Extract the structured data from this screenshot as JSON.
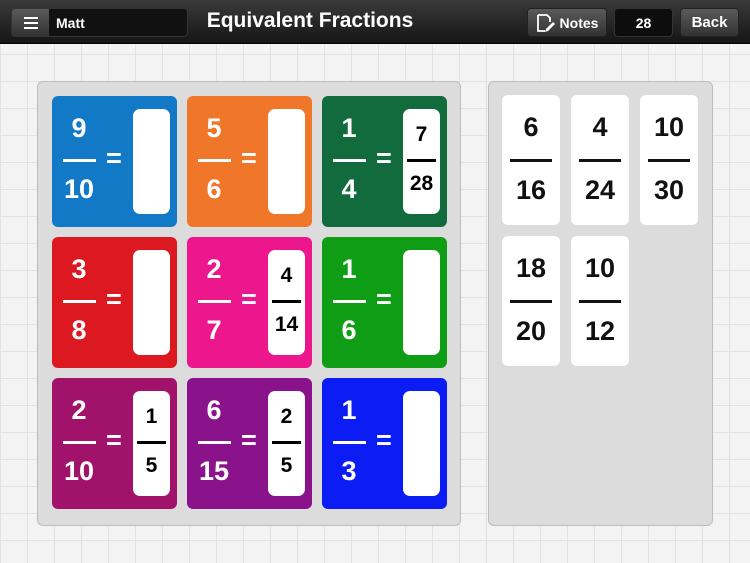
{
  "header": {
    "user_name": "Matt",
    "title": "Equivalent Fractions",
    "notes_label": "Notes",
    "score": "28",
    "back_label": "Back"
  },
  "problems": [
    {
      "num": "9",
      "den": "10",
      "color": "#1279c6",
      "answer": null
    },
    {
      "num": "5",
      "den": "6",
      "color": "#f0762a",
      "answer": null
    },
    {
      "num": "1",
      "den": "4",
      "color": "#116b3c",
      "answer": {
        "num": "7",
        "den": "28"
      }
    },
    {
      "num": "3",
      "den": "8",
      "color": "#dc1920",
      "answer": null
    },
    {
      "num": "2",
      "den": "7",
      "color": "#ec178c",
      "answer": {
        "num": "4",
        "den": "14"
      }
    },
    {
      "num": "1",
      "den": "6",
      "color": "#109d16",
      "answer": null
    },
    {
      "num": "2",
      "den": "10",
      "color": "#a1126a",
      "answer": {
        "num": "1",
        "den": "5"
      }
    },
    {
      "num": "6",
      "den": "15",
      "color": "#8a128a",
      "answer": {
        "num": "2",
        "den": "5"
      }
    },
    {
      "num": "1",
      "den": "3",
      "color": "#0c1cf5",
      "answer": null
    }
  ],
  "tiles": [
    {
      "num": "6",
      "den": "16"
    },
    {
      "num": "4",
      "den": "24"
    },
    {
      "num": "10",
      "den": "30"
    },
    {
      "num": "18",
      "den": "20"
    },
    {
      "num": "10",
      "den": "12"
    }
  ]
}
